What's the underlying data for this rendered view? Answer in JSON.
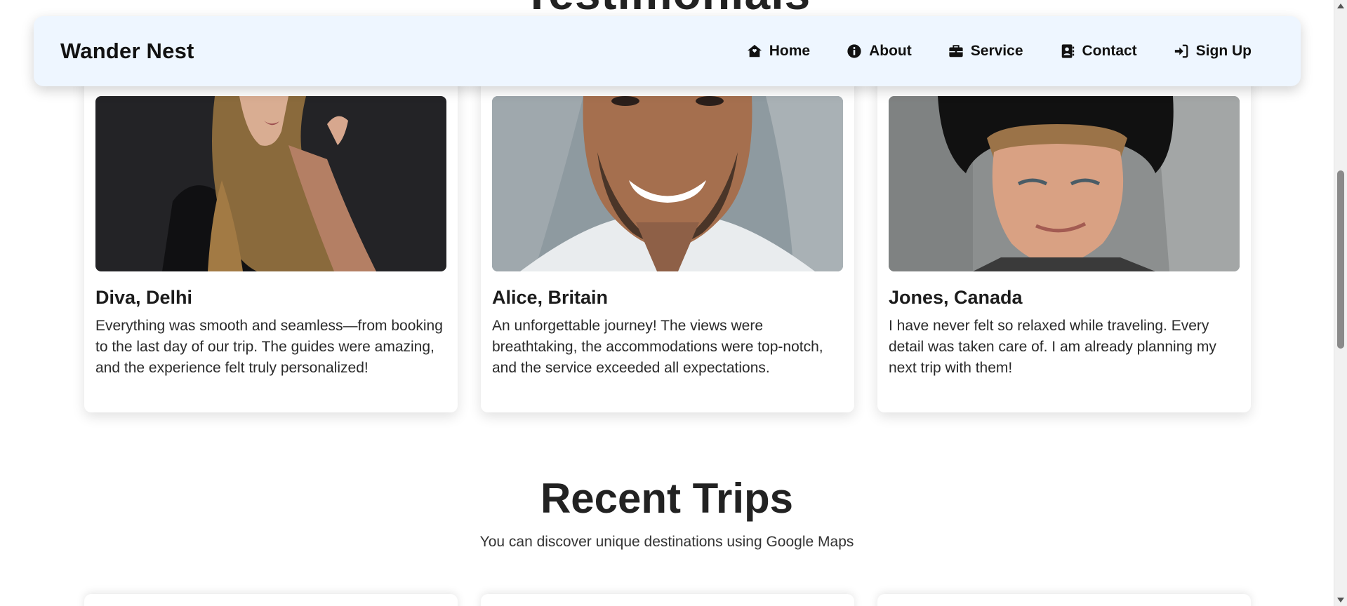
{
  "previous_section_title": "Testimonials",
  "navbar": {
    "brand": "Wander Nest",
    "links": [
      {
        "label": "Home",
        "icon": "home-icon"
      },
      {
        "label": "About",
        "icon": "info-icon"
      },
      {
        "label": "Service",
        "icon": "briefcase-icon"
      },
      {
        "label": "Contact",
        "icon": "contact-book-icon"
      },
      {
        "label": "Sign Up",
        "icon": "sign-in-icon"
      }
    ]
  },
  "testimonials": [
    {
      "name": "Diva, Delhi",
      "text": "Everything was smooth and seamless—from booking to the last day of our trip. The guides were amazing, and the experience felt truly personalized!",
      "photo": "woman-portrait-photo"
    },
    {
      "name": "Alice, Britain",
      "text": "An unforgettable journey! The views were breathtaking, the accommodations were top-notch, and the service exceeded all expectations.",
      "photo": "smiling-man-portrait-photo"
    },
    {
      "name": "Jones, Canada",
      "text": "I have never felt so relaxed while traveling. Every detail was taken care of. I am already planning my next trip with them!",
      "photo": "man-with-hat-portrait-photo"
    }
  ],
  "recent_trips": {
    "title": "Recent Trips",
    "subtitle": "You can discover unique destinations using Google Maps"
  },
  "colors": {
    "navbar_bg": "#eef6ff",
    "text_dark": "#222222",
    "card_bg": "#ffffff"
  }
}
